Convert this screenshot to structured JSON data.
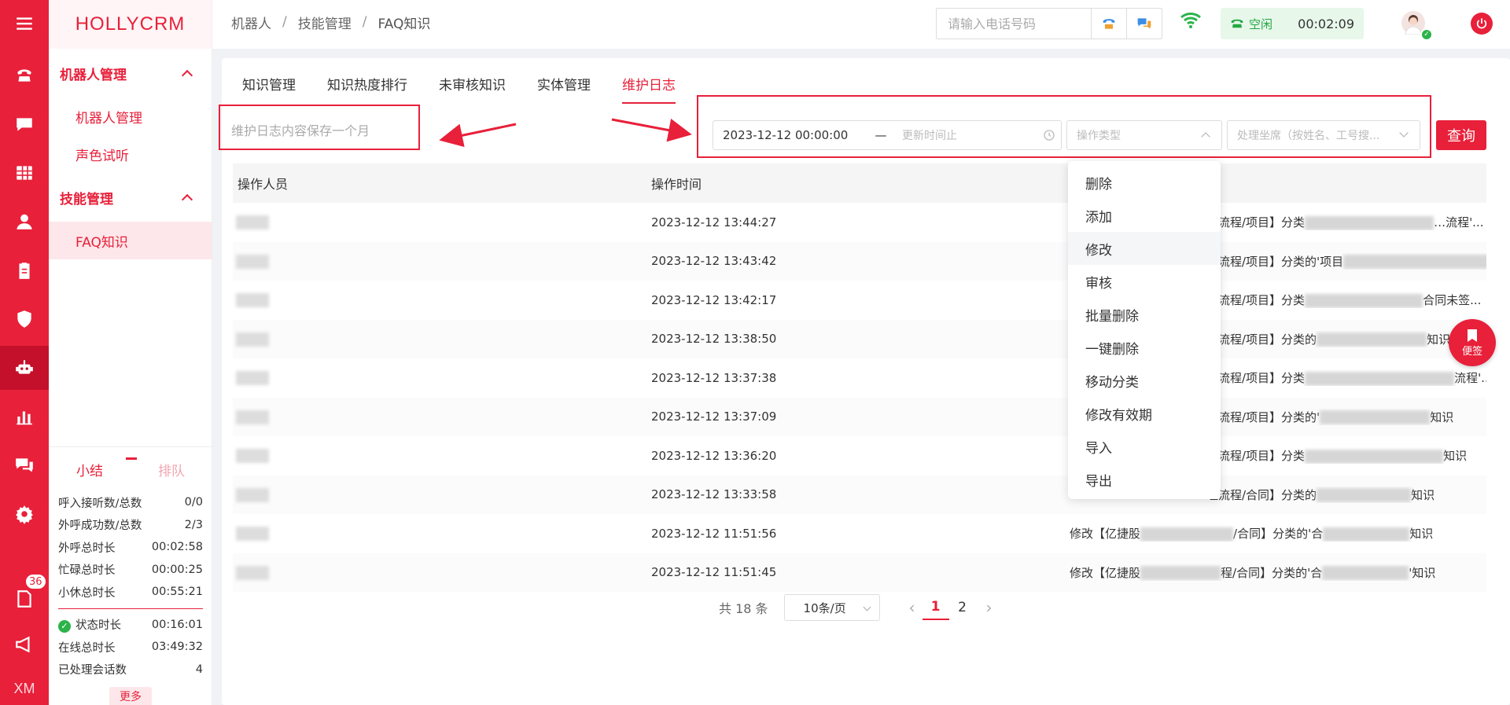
{
  "brand": "HOLLYCRM",
  "rail": {
    "badge_count": "36",
    "footer": "XM"
  },
  "sidebar": {
    "groups": [
      {
        "label": "机器人管理",
        "items": [
          "机器人管理",
          "声色试听"
        ]
      },
      {
        "label": "技能管理",
        "items": [
          "FAQ知识"
        ]
      }
    ]
  },
  "summary": {
    "tab_active": "小结",
    "tab_inactive": "排队",
    "stats": [
      {
        "label": "呼入接听数/总数",
        "value": "0/0"
      },
      {
        "label": "外呼成功数/总数",
        "value": "2/3"
      },
      {
        "label": "外呼总时长",
        "value": "00:02:58"
      },
      {
        "label": "忙碌总时长",
        "value": "00:00:25"
      },
      {
        "label": "小休总时长",
        "value": "00:55:21"
      }
    ],
    "stats2": [
      {
        "label": "状态时长",
        "value": "00:16:01"
      },
      {
        "label": "在线总时长",
        "value": "03:49:32"
      },
      {
        "label": "已处理会话数",
        "value": "4"
      }
    ],
    "more": "更多"
  },
  "header": {
    "breadcrumb": [
      "机器人",
      "技能管理",
      "FAQ知识"
    ],
    "phone_placeholder": "请输入电话号码",
    "status": "空闲",
    "timer": "00:02:09"
  },
  "tabs": [
    "知识管理",
    "知识热度排行",
    "未审核知识",
    "实体管理",
    "维护日志"
  ],
  "note": "维护日志内容保存一个月",
  "filters": {
    "date_start": "2023-12-12 00:00:00",
    "date_sep": "—",
    "date_end_placeholder": "更新时间止",
    "op_type_placeholder": "操作类型",
    "agent_placeholder": "处理坐席（按姓名、工号搜...",
    "query": "查询"
  },
  "table": {
    "columns": [
      "操作人员",
      "操作时间",
      ""
    ],
    "rows": [
      {
        "time": "2023-12-12 13:44:27",
        "c3a": "理流程/项目】分类",
        "c3b": "…流程'..."
      },
      {
        "time": "2023-12-12 13:43:42",
        "c3a": "理流程/项目】分类的'项目",
        "c3b": ""
      },
      {
        "time": "2023-12-12 13:42:17",
        "c3a": "理流程/项目】分类",
        "c3b": "合同未签..."
      },
      {
        "time": "2023-12-12 13:38:50",
        "c3a": "理流程/项目】分类的",
        "c3b": "知识"
      },
      {
        "time": "2023-12-12 13:37:38",
        "c3a": "理流程/项目】分类",
        "c3b": "流程'..."
      },
      {
        "time": "2023-12-12 13:37:09",
        "c3a": "理流程/项目】分类的'",
        "c3b": "知识"
      },
      {
        "time": "2023-12-12 13:36:20",
        "c3a": "理流程/项目】分类",
        "c3b": "知识"
      },
      {
        "time": "2023-12-12 13:33:58",
        "c3a": "理流程/合同】分类的",
        "c3b": "知识"
      },
      {
        "time": "2023-12-12 11:51:56",
        "c3a": "修改【亿捷股",
        "c3m": "/合同】分类的'合",
        "c3b": "知识"
      },
      {
        "time": "2023-12-12 11:51:45",
        "c3a": "修改【亿捷股",
        "c3m": "程/合同】分类的'合",
        "c3b": "'知识"
      }
    ]
  },
  "pager": {
    "total": "共 18 条",
    "size": "10条/页",
    "pages": [
      "1",
      "2"
    ],
    "current": "1"
  },
  "dropdown": {
    "options": [
      "删除",
      "添加",
      "修改",
      "审核",
      "批量删除",
      "一键删除",
      "移动分类",
      "修改有效期",
      "导入",
      "导出"
    ],
    "hover_index": 2
  },
  "float_button": "便签",
  "colors": {
    "accent": "#e8203a",
    "status_green": "#24a744"
  }
}
